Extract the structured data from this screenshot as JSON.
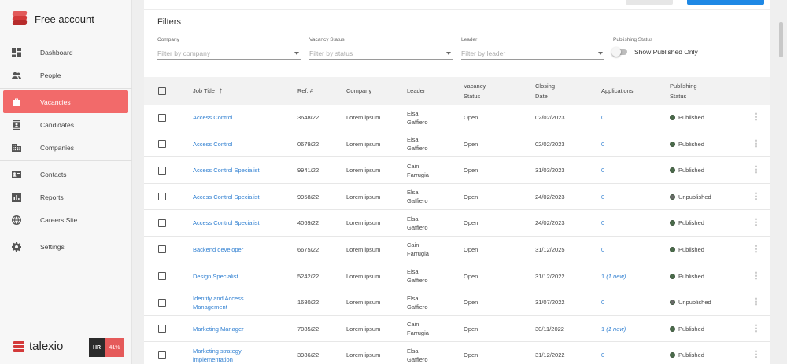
{
  "brand": {
    "name": "Free account"
  },
  "nav": [
    {
      "label": "Dashboard",
      "icon": "dashboard-icon",
      "active": false
    },
    {
      "label": "People",
      "icon": "people-icon",
      "active": false
    },
    {
      "label": "Vacancies",
      "icon": "briefcase-icon",
      "active": true
    },
    {
      "label": "Candidates",
      "icon": "candidates-icon",
      "active": false
    },
    {
      "label": "Companies",
      "icon": "companies-icon",
      "active": false
    },
    {
      "label": "Contacts",
      "icon": "contacts-icon",
      "active": false
    },
    {
      "label": "Reports",
      "icon": "reports-icon",
      "active": false
    },
    {
      "label": "Careers Site",
      "icon": "globe-icon",
      "active": false
    },
    {
      "label": "Settings",
      "icon": "gear-icon",
      "active": false
    }
  ],
  "footer": {
    "brand": "talexio",
    "badge_left": "HR",
    "badge_right": "41%"
  },
  "filters": {
    "title": "Filters",
    "company": {
      "label": "Company",
      "placeholder": "Filter by company"
    },
    "status": {
      "label": "Vacancy Status",
      "placeholder": "Filter by status"
    },
    "leader": {
      "label": "Leader",
      "placeholder": "Filter by leader"
    },
    "publishing": {
      "label": "Publishing Status",
      "toggle_label": "Show Published Only"
    }
  },
  "table": {
    "headers": {
      "job_title": "Job Title",
      "ref": "Ref. #",
      "company": "Company",
      "leader": "Leader",
      "vacancy_status": "Vacancy Status",
      "closing_date": "Closing Date",
      "applications": "Applications",
      "publishing_status": "Publishing Status"
    },
    "rows": [
      {
        "title": "Access Control",
        "ref": "3648/22",
        "company": "Lorem ipsum",
        "leader": "Elsa Gaffiero",
        "status": "Open",
        "date": "02/02/2023",
        "apps": "0",
        "apps_new": "",
        "pub": "Published"
      },
      {
        "title": "Access Control",
        "ref": "0679/22",
        "company": "Lorem ipsum",
        "leader": "Elsa Gaffiero",
        "status": "Open",
        "date": "02/02/2023",
        "apps": "0",
        "apps_new": "",
        "pub": "Published"
      },
      {
        "title": "Access Control Specialist",
        "ref": "9941/22",
        "company": "Lorem ipsum",
        "leader": "Cain Farrugia",
        "status": "Open",
        "date": "31/03/2023",
        "apps": "0",
        "apps_new": "",
        "pub": "Published"
      },
      {
        "title": "Access Control Specialist",
        "ref": "9958/22",
        "company": "Lorem ipsum",
        "leader": "Elsa Gaffiero",
        "status": "Open",
        "date": "24/02/2023",
        "apps": "0",
        "apps_new": "",
        "pub": "Unpublished"
      },
      {
        "title": "Access Control Specialist",
        "ref": "4069/22",
        "company": "Lorem ipsum",
        "leader": "Elsa Gaffiero",
        "status": "Open",
        "date": "24/02/2023",
        "apps": "0",
        "apps_new": "",
        "pub": "Published"
      },
      {
        "title": "Backend developer",
        "ref": "6675/22",
        "company": "Lorem ipsum",
        "leader": "Cain Farrugia",
        "status": "Open",
        "date": "31/12/2025",
        "apps": "0",
        "apps_new": "",
        "pub": "Published"
      },
      {
        "title": "Design Specialist",
        "ref": "5242/22",
        "company": "Lorem ipsum",
        "leader": "Elsa Gaffiero",
        "status": "Open",
        "date": "31/12/2022",
        "apps": "1",
        "apps_new": "(1 new)",
        "pub": "Published"
      },
      {
        "title": "Identity and Access Management",
        "ref": "1680/22",
        "company": "Lorem ipsum",
        "leader": "Elsa Gaffiero",
        "status": "Open",
        "date": "31/07/2022",
        "apps": "0",
        "apps_new": "",
        "pub": "Unpublished"
      },
      {
        "title": "Marketing Manager",
        "ref": "7085/22",
        "company": "Lorem ipsum",
        "leader": "Cain Farrugia",
        "status": "Open",
        "date": "30/11/2022",
        "apps": "1",
        "apps_new": "(1 new)",
        "pub": "Published"
      },
      {
        "title": "Marketing strategy implementation",
        "ref": "3986/22",
        "company": "Lorem ipsum",
        "leader": "Elsa Gaffiero",
        "status": "Open",
        "date": "31/12/2022",
        "apps": "0",
        "apps_new": "",
        "pub": "Published"
      }
    ]
  },
  "colors": {
    "accent": "#f26a6a",
    "link": "#2f7fd1",
    "primary_button": "#1e88e5"
  }
}
